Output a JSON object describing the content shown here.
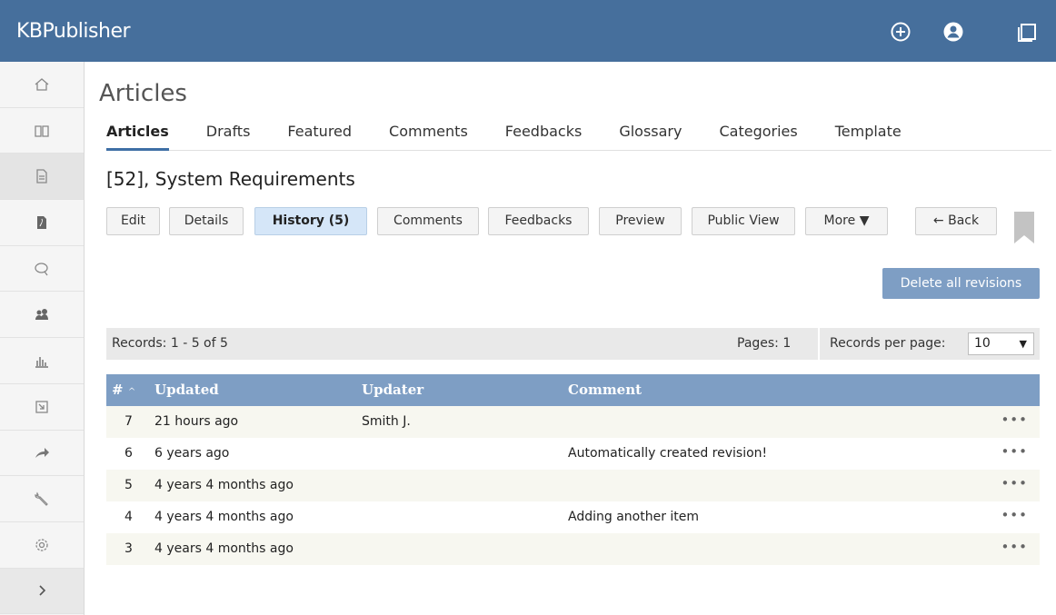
{
  "app": {
    "brand": "KBPublisher"
  },
  "topbar": {
    "icons": [
      "plus-circle-icon",
      "user-circle-icon",
      "window-icon"
    ]
  },
  "sidebar": {
    "items": [
      {
        "icon": "home-icon"
      },
      {
        "icon": "book-icon"
      },
      {
        "icon": "document-icon",
        "active": true
      },
      {
        "icon": "pdf-file-icon"
      },
      {
        "icon": "chat-icon"
      },
      {
        "icon": "users-icon"
      },
      {
        "icon": "bar-chart-icon"
      },
      {
        "icon": "import-icon"
      },
      {
        "icon": "share-arrow-icon"
      },
      {
        "icon": "wrench-icon"
      },
      {
        "icon": "gear-icon"
      },
      {
        "icon": "chevron-right-icon"
      }
    ]
  },
  "page": {
    "title": "Articles"
  },
  "tabs": [
    {
      "label": "Articles",
      "active": true
    },
    {
      "label": "Drafts"
    },
    {
      "label": "Featured"
    },
    {
      "label": "Comments"
    },
    {
      "label": "Feedbacks"
    },
    {
      "label": "Glossary"
    },
    {
      "label": "Categories"
    },
    {
      "label": "Template"
    }
  ],
  "article": {
    "title": "[52], System Requirements"
  },
  "actions": {
    "edit": "Edit",
    "details": "Details",
    "history": "History (5)",
    "comments": "Comments",
    "feedbacks": "Feedbacks",
    "preview": "Preview",
    "public_view": "Public View",
    "more": "More ▼",
    "back": "← Back"
  },
  "delete_all": "Delete all revisions",
  "records": {
    "summary": "Records: 1 - 5 of 5",
    "pages": "Pages: 1",
    "per_page_label": "Records per page:",
    "per_page_value": "10",
    "per_page_arrow": "▼"
  },
  "table": {
    "headers": {
      "num": "#",
      "sort": "^",
      "updated": "Updated",
      "updater": "Updater",
      "comment": "Comment"
    },
    "rows": [
      {
        "num": "7",
        "updated": "21 hours ago",
        "updater": "Smith J.",
        "comment": "",
        "menu": "•••"
      },
      {
        "num": "6",
        "updated": "6 years ago",
        "updater": "",
        "comment": "Automatically created revision!",
        "menu": "•••"
      },
      {
        "num": "5",
        "updated": "4 years 4 months ago",
        "updater": "",
        "comment": "",
        "menu": "•••"
      },
      {
        "num": "4",
        "updated": "4 years 4 months ago",
        "updater": "",
        "comment": "Adding another item",
        "menu": "•••"
      },
      {
        "num": "3",
        "updated": "4 years 4 months ago",
        "updater": "",
        "comment": "",
        "menu": "•••"
      }
    ]
  },
  "colors": {
    "topbar": "#466f9c",
    "table_header": "#7e9ec4",
    "active_button": "#d5e6f8",
    "tab_underline": "#3e6fa5"
  }
}
